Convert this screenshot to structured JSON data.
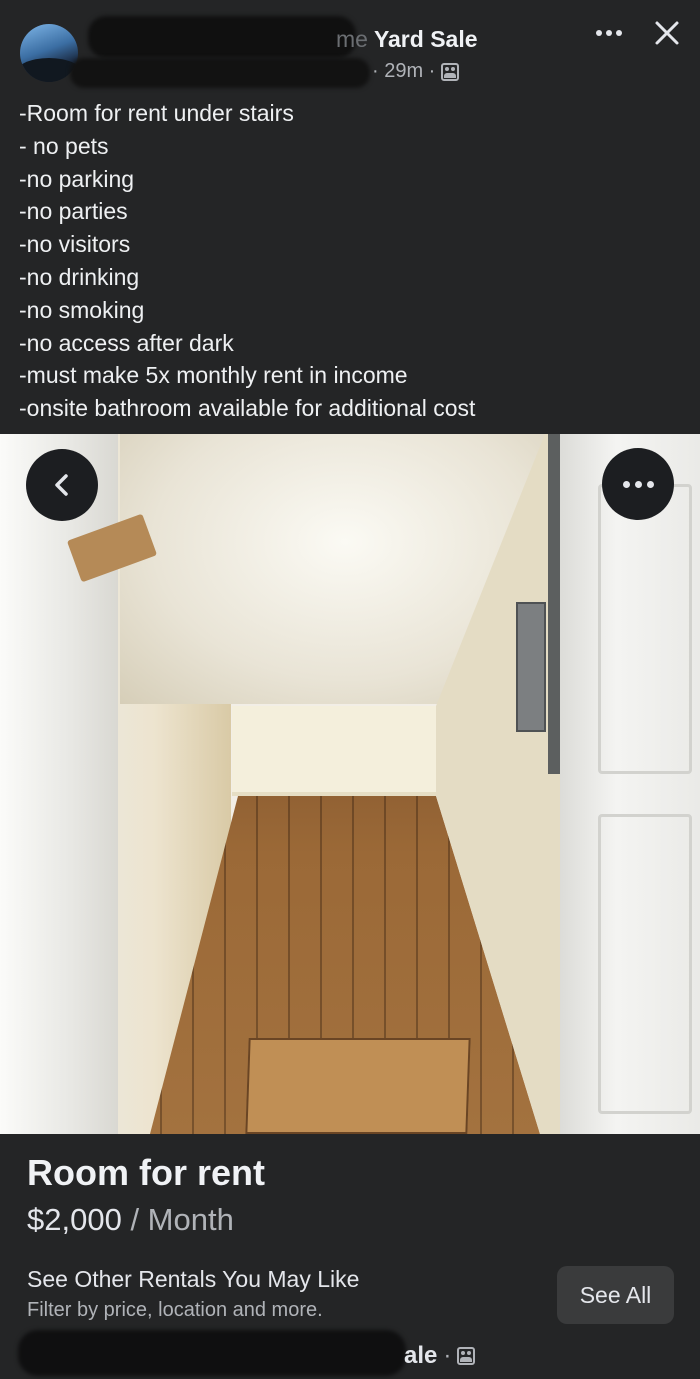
{
  "header": {
    "group_name_faded": "me",
    "group_name": "Yard Sale",
    "time_ago": "· 29m ·",
    "privacy_icon": "group-members-icon",
    "more_icon": "more-dots-icon",
    "close_icon": "close-icon"
  },
  "post": {
    "lines": [
      "-Room for rent under stairs",
      "- no pets",
      "-no parking",
      "-no parties",
      "-no visitors",
      "-no drinking",
      "-no smoking",
      "-no access after dark",
      "-must make 5x monthly rent in income",
      "-onsite bathroom available for additional cost"
    ]
  },
  "photo": {
    "back_icon": "chevron-left-icon",
    "more_icon": "more-dots-icon"
  },
  "listing": {
    "title": "Room for rent",
    "price": "$2,000",
    "per": " / Month"
  },
  "rentals": {
    "heading": "See Other Rentals You May Like",
    "subtext": "Filter by price, location and more.",
    "button": "See All"
  },
  "footer": {
    "group_suffix": "ale",
    "dot": "·"
  },
  "colors": {
    "background": "#242526",
    "button": "#3a3b3c",
    "text_primary": "#e4e6eb",
    "text_secondary": "#b0b3b8"
  }
}
